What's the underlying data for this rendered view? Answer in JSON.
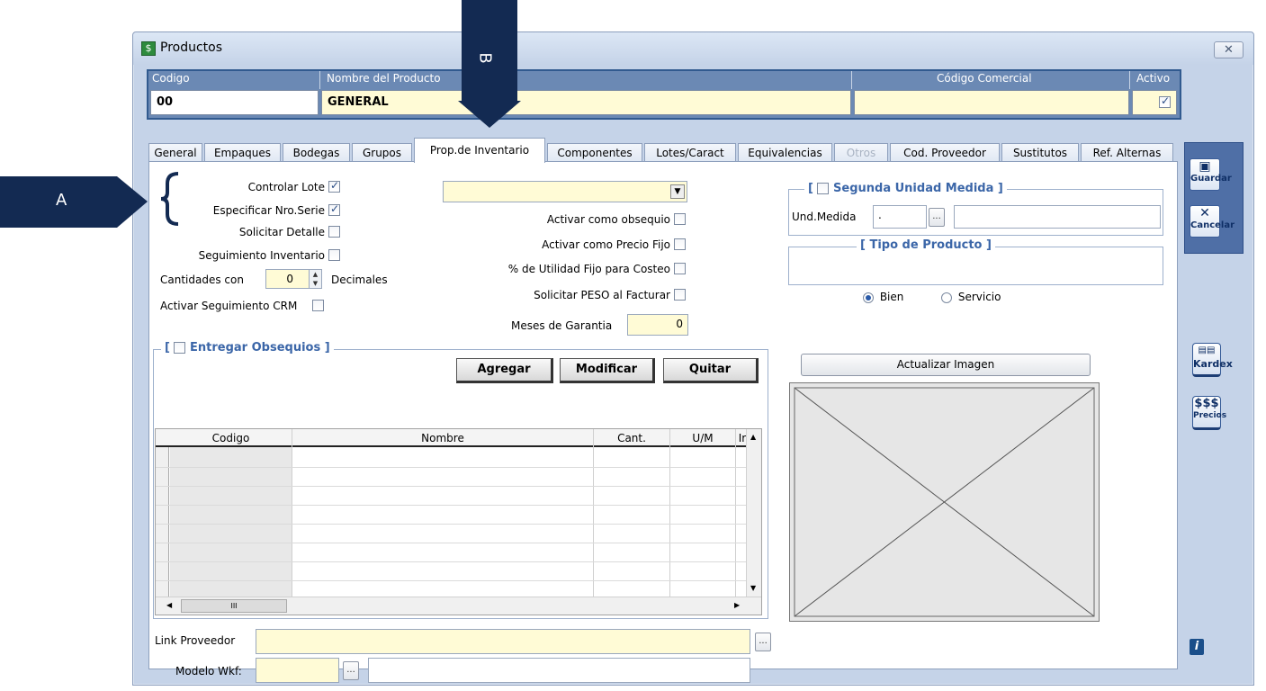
{
  "window": {
    "title": "Productos",
    "close_glyph": "✕"
  },
  "header": {
    "labels": {
      "codigo": "Codigo",
      "nombre": "Nombre del Producto",
      "codigo_comercial": "Código Comercial",
      "activo": "Activo"
    },
    "values": {
      "codigo": "00",
      "nombre": "GENERAL",
      "codigo_comercial": "",
      "activo": true
    }
  },
  "tabs": [
    {
      "label": "General"
    },
    {
      "label": "Empaques"
    },
    {
      "label": "Bodegas"
    },
    {
      "label": "Grupos"
    },
    {
      "label": "Prop.de Inventario",
      "active": true
    },
    {
      "label": "Componentes"
    },
    {
      "label": "Lotes/Caract"
    },
    {
      "label": "Equivalencias"
    },
    {
      "label": "Otros",
      "disabled": true
    },
    {
      "label": "Cod. Proveedor"
    },
    {
      "label": "Sustitutos"
    },
    {
      "label": "Ref. Alternas"
    }
  ],
  "inventory": {
    "controlar_lote": {
      "label": "Controlar Lote",
      "checked": true
    },
    "especificar_serie": {
      "label": "Especificar Nro.Serie",
      "checked": true
    },
    "solicitar_detalle": {
      "label": "Solicitar Detalle",
      "checked": false
    },
    "seguimiento_inventario": {
      "label": "Seguimiento Inventario",
      "checked": false
    },
    "cantidades_con": "Cantidades con",
    "decimales_value": "0",
    "decimales_label": "Decimales",
    "seguimiento_crm": {
      "label": "Activar Seguimiento CRM",
      "checked": false
    },
    "dropdown_value": "",
    "activar_obsequio": {
      "label": "Activar como obsequio",
      "checked": false
    },
    "precio_fijo": {
      "label": "Activar como Precio Fijo",
      "checked": false
    },
    "utilidad_fijo": {
      "label": "% de Utilidad Fijo para Costeo",
      "checked": false
    },
    "solicitar_peso": {
      "label": "Solicitar  PESO  al  Facturar",
      "checked": false
    },
    "meses_garantia_label": "Meses de Garantia",
    "meses_garantia_value": "0"
  },
  "obsequios": {
    "title": "Entregar Obsequios ]",
    "bracket": "[",
    "buttons": {
      "agregar": "Agregar",
      "modificar": "Modificar",
      "quitar": "Quitar"
    },
    "columns": [
      "Codigo",
      "Nombre",
      "Cant.",
      "U/M",
      "Ir"
    ],
    "scroll_thumb": "III"
  },
  "segunda_unidad": {
    "title": "Segunda Unidad Medida ]",
    "bracket": "[",
    "und_label": "Und.Medida",
    "und_value": ".",
    "ellipsis": "..."
  },
  "tipo_producto": {
    "title": "[  Tipo de Producto ]",
    "options": [
      {
        "label": "Bien",
        "selected": true
      },
      {
        "label": "Servicio",
        "selected": false
      }
    ]
  },
  "image": {
    "button": "Actualizar Imagen"
  },
  "links": {
    "proveedor_label": "Link Proveedor",
    "proveedor_value": "",
    "modelo_label": "Modelo Wkf:",
    "modelo_value": "",
    "modelo_desc": ""
  },
  "toolbar": {
    "guardar": "Guardar",
    "cancelar": "Cancelar",
    "kardex": "Kardex",
    "precios_symbol": "$$$",
    "precios": "Precios",
    "info": "i"
  },
  "annotations": {
    "a": "A",
    "b": "B"
  },
  "colors": {
    "accent": "#132a52",
    "field_yellow": "#fffbd6",
    "header_blue": "#6b89b4"
  }
}
